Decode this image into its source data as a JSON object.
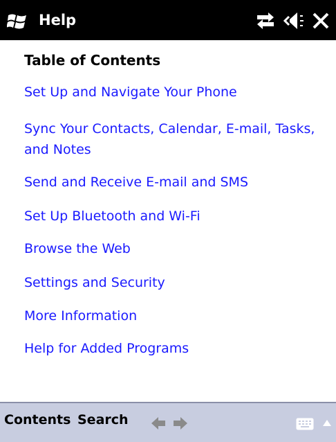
{
  "titlebar": {
    "title": "Help",
    "icons": [
      "windows-start-icon",
      "connectivity-icon",
      "volume-icon",
      "close-icon"
    ]
  },
  "toc": {
    "heading": "Table of Contents",
    "links": [
      "Set Up and Navigate Your Phone",
      "Sync Your Contacts, Calendar, E-mail, Tasks, and Notes",
      "Send and Receive E-mail and SMS",
      "Set Up Bluetooth and Wi-Fi",
      "Browse the Web",
      "Settings and Security",
      "More Information",
      "Help for Added Programs"
    ]
  },
  "menubar": {
    "contents_label": "Contents",
    "search_label": "Search",
    "icons": [
      "back-arrow-icon",
      "forward-arrow-icon",
      "keyboard-icon",
      "menu-up-icon"
    ]
  },
  "colors": {
    "link": "#1a1aff",
    "titlebar_bg": "#000000",
    "menubar_bg": "#c8cde0"
  }
}
